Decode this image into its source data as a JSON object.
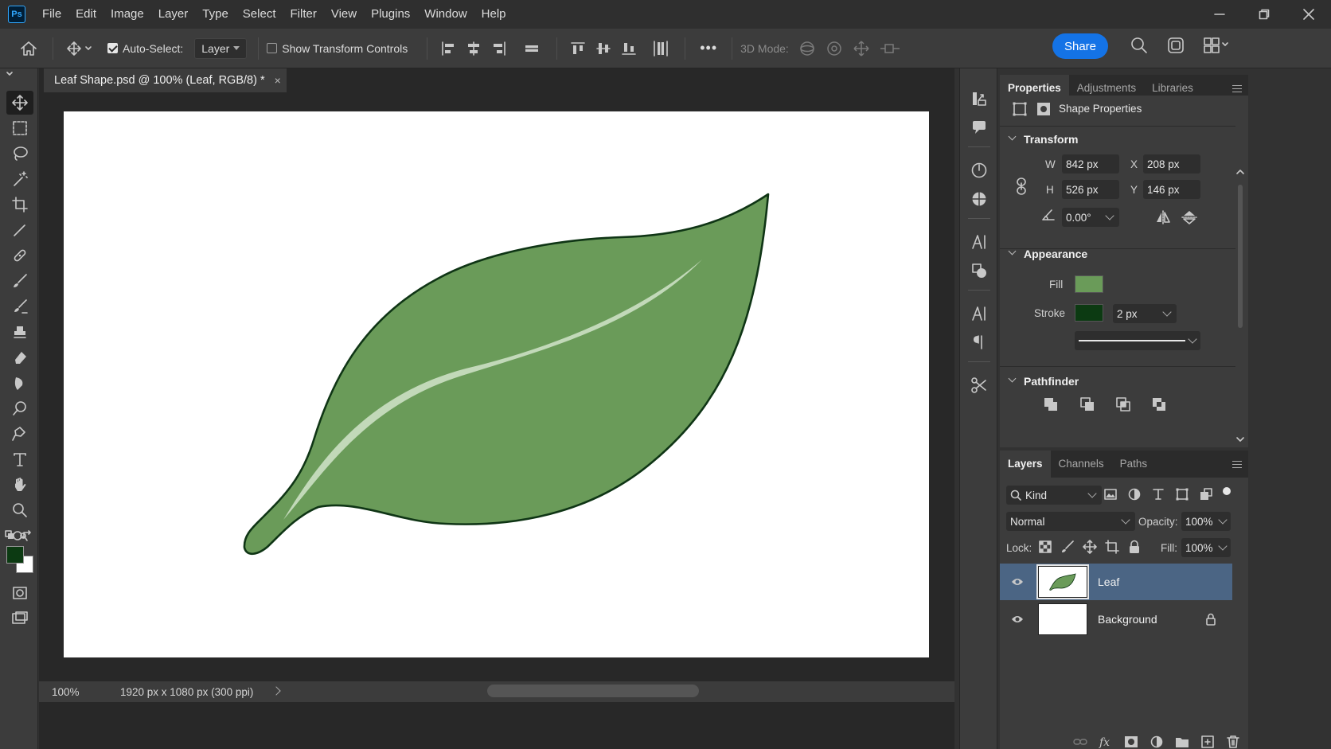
{
  "app": {
    "logo": "Ps",
    "menu": [
      "File",
      "Edit",
      "Image",
      "Layer",
      "Type",
      "Select",
      "Filter",
      "View",
      "Plugins",
      "Window",
      "Help"
    ]
  },
  "options_bar": {
    "auto_select_label": "Auto-Select:",
    "auto_select_checked": true,
    "auto_select_target": "Layer",
    "show_transform_label": "Show Transform Controls",
    "show_transform_checked": false,
    "more_label": "•••",
    "mode_3d_label": "3D Mode:",
    "share_label": "Share"
  },
  "document": {
    "tab_title": "Leaf Shape.psd @ 100% (Leaf, RGB/8) *",
    "close_glyph": "×",
    "zoom": "100%",
    "size_info": "1920 px x 1080 px (300 ppi)",
    "canvas_bg": "#ffffff",
    "leaf_fill": "#6a9b59",
    "leaf_stroke": "#0f3515",
    "vein_color": "#c7dcbf"
  },
  "tools": [
    "move-tool",
    "marquee-tool",
    "lasso-tool",
    "magic-wand-tool",
    "crop-tool",
    "eyedropper-tool",
    "healing-brush-tool",
    "brush-tool",
    "clone-stamp-tool",
    "eraser-tool",
    "bucket-tool",
    "dodge-tool",
    "pen-tool",
    "type-tool",
    "hand-tool",
    "zoom-tool"
  ],
  "colors": {
    "foreground": "#0c3a12",
    "background": "#ffffff",
    "accent": "#1473e6",
    "selected_layer": "#4b6584"
  },
  "properties": {
    "tabs": [
      "Properties",
      "Adjustments",
      "Libraries"
    ],
    "active_tab": "Properties",
    "header": "Shape Properties",
    "transform": {
      "title": "Transform",
      "w_label": "W",
      "w": "842 px",
      "h_label": "H",
      "h": "526 px",
      "x_label": "X",
      "x": "208 px",
      "y_label": "Y",
      "y": "146 px",
      "angle": "0.00°"
    },
    "appearance": {
      "title": "Appearance",
      "fill_label": "Fill",
      "fill_color": "#6a9b59",
      "stroke_label": "Stroke",
      "stroke_color": "#0c3a12",
      "stroke_width": "2 px"
    },
    "pathfinder": {
      "title": "Pathfinder"
    }
  },
  "layers_panel": {
    "tabs": [
      "Layers",
      "Channels",
      "Paths"
    ],
    "active_tab": "Layers",
    "filter_kind": "Kind",
    "blend_mode": "Normal",
    "opacity_label": "Opacity:",
    "opacity": "100%",
    "lock_label": "Lock:",
    "fill_label": "Fill:",
    "fill": "100%",
    "layers": [
      {
        "name": "Leaf",
        "selected": true,
        "visible": true,
        "locked": false
      },
      {
        "name": "Background",
        "selected": false,
        "visible": true,
        "locked": true
      }
    ]
  }
}
